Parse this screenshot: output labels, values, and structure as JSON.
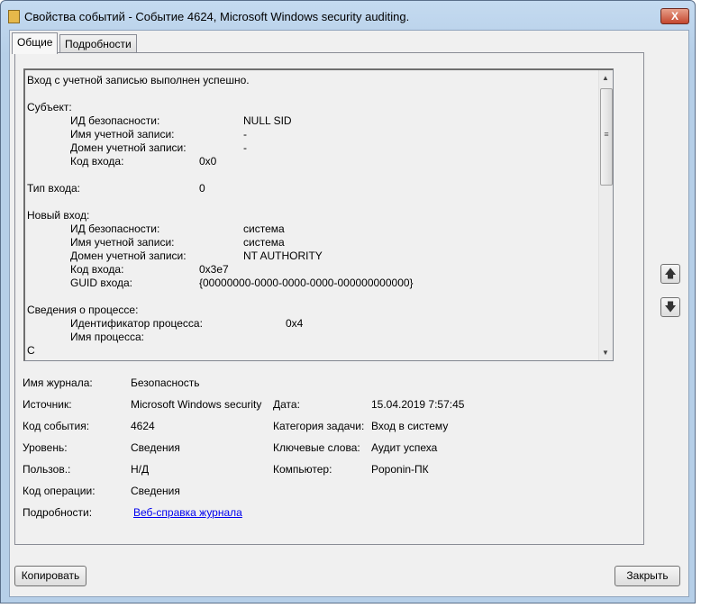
{
  "window": {
    "title": "Свойства событий - Событие 4624, Microsoft Windows security auditing.",
    "close": "X"
  },
  "tabs": [
    {
      "label": "Общие"
    },
    {
      "label": "Подробности"
    }
  ],
  "message": [
    {
      "t": "Вход с учетной записью выполнен успешно.",
      "v": ""
    },
    {
      "t": "Субъект:",
      "v": ""
    },
    {
      "t": "ИД безопасности:",
      "v": "NULL SID"
    },
    {
      "t": "Имя учетной записи:",
      "v": "-"
    },
    {
      "t": "Домен учетной записи:",
      "v": "-"
    },
    {
      "t": "Код входа:",
      "v": "0x0"
    },
    {
      "t": "Тип входа:",
      "v": "0"
    },
    {
      "t": "Новый вход:",
      "v": ""
    },
    {
      "t": "ИД безопасности:",
      "v": "система"
    },
    {
      "t": "Имя учетной записи:",
      "v": "система"
    },
    {
      "t": "Домен учетной записи:",
      "v": "NT AUTHORITY"
    },
    {
      "t": "Код входа:",
      "v": "0x3e7"
    },
    {
      "t": "GUID входа:",
      "v": "{00000000-0000-0000-0000-000000000000}"
    },
    {
      "t": "Сведения о процессе:",
      "v": ""
    },
    {
      "t": "Идентификатор процесса:",
      "v": "0x4"
    },
    {
      "t": "Имя процесса:",
      "v": ""
    },
    {
      "t": "С",
      "v": ""
    }
  ],
  "details": {
    "log_label": "Имя журнала:",
    "log": "Безопасность",
    "source_label": "Источник:",
    "source": "Microsoft Windows security",
    "date_label": "Дата:",
    "date": "15.04.2019 7:57:45",
    "id_label": "Код события:",
    "id": "4624",
    "category_label": "Категория задачи:",
    "category": "Вход в систему",
    "level_label": "Уровень:",
    "level": "Сведения",
    "keywords_label": "Ключевые слова:",
    "keywords": "Аудит успеха",
    "user_label": "Пользов.:",
    "user": "Н/Д",
    "computer_label": "Компьютер:",
    "computer": "Poponin-ПК",
    "opcode_label": "Код операции:",
    "opcode": "Сведения",
    "more_label": "Подробности:",
    "more_link": "Веб-справка журнала"
  },
  "buttons": {
    "copy": "Копировать",
    "close": "Закрыть"
  }
}
